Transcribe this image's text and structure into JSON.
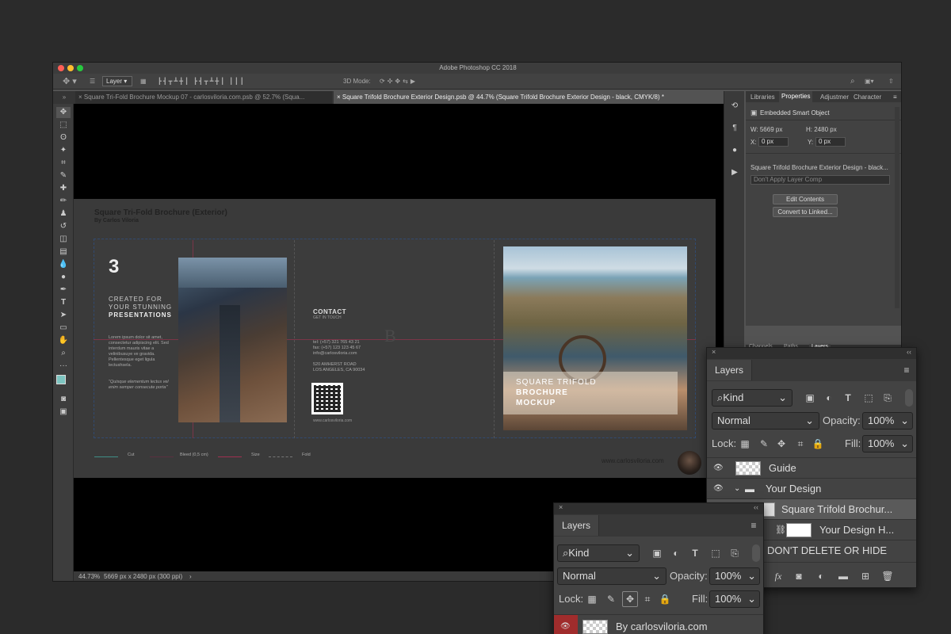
{
  "app": {
    "title": "Adobe Photoshop CC 2018"
  },
  "options": {
    "layer_select": "Layer",
    "mode3d": "3D Mode:"
  },
  "tabs": [
    {
      "label": "Square Tri-Fold Brochure Mockup 07 - carlosviloria.com.psb @ 52.7% (Squa..."
    },
    {
      "label": "Square Trifold Brochure Exterior Design.psb @ 44.7% (Square Trifold Brochure Exterior Design - black, CMYK/8) *"
    }
  ],
  "brochure": {
    "title": "Square Tri-Fold Brochure (Exterior)",
    "author": "By Carlos Viloria",
    "number": "3",
    "tag1": "CREATED FOR",
    "tag2": "YOUR STUNNING",
    "tag3": "PRESENTATIONS",
    "lorem": "Lorem ipsum dolor sit amet, consectetur adipiscing elit. Sed interdum mauris vitae a velinibusuye ve gravida. Pellentesque eget ligula lectushsela.",
    "quote": "\"Quisque elementum lectus vel enim semper consecute porta\"",
    "contact": "CONTACT",
    "touch": "GET IN TOUCH",
    "tel": "tel: (+57) 321 765 43 21",
    "fax": "fax: (+57) 123 123 45 67",
    "email": "info@carlosviloria.com",
    "addr1": "520 AMHERST ROAD",
    "addr2": "LOS ANGELES, CA 90034",
    "site_small": "www.carlosviloria.com",
    "mock1": "SQUARE TRIFOLD",
    "mock2": "BROCHURE",
    "mock3": "MOCKUP",
    "legend_cut": "Cut",
    "legend_bleed": "Bleed (0,5 cm)",
    "legend_size": "Size",
    "legend_fold": "Fold",
    "site": "www.carlosviloria.com"
  },
  "status": {
    "zoom": "44.73%",
    "dims": "5669 px x 2480 px (300 ppi)"
  },
  "panel": {
    "tabs": [
      "Libraries",
      "Properties",
      "Adjustmer",
      "Character"
    ],
    "smart": "Embedded Smart Object",
    "w": "W: 5669 px",
    "h": "H: 2480 px",
    "x_label": "X:",
    "x_val": "0 px",
    "y_label": "Y:",
    "y_val": "0 px",
    "source": "Square Trifold Brochure Exterior Design - black...",
    "comp": "Don't Apply Layer Comp",
    "edit": "Edit Contents",
    "convert": "Convert to Linked...",
    "bottom_tabs": [
      "Channels",
      "Paths",
      "Layers"
    ]
  },
  "layers_big": {
    "title": "Layers",
    "kind": "Kind",
    "blend": "Normal",
    "opacity_label": "Opacity:",
    "opacity": "100%",
    "lock_label": "Lock:",
    "fill_label": "Fill:",
    "fill": "100%",
    "rows": [
      "Guide",
      "Your Design",
      "Square Trifold Brochur...",
      "Your Design H...",
      "DON'T DELETE OR HIDE"
    ]
  },
  "layers_small": {
    "title": "Layers",
    "kind": "Kind",
    "blend": "Normal",
    "opacity_label": "Opacity:",
    "opacity": "100%",
    "lock_label": "Lock:",
    "fill_label": "Fill:",
    "fill": "100%",
    "row": "By carlosviloria.com"
  }
}
